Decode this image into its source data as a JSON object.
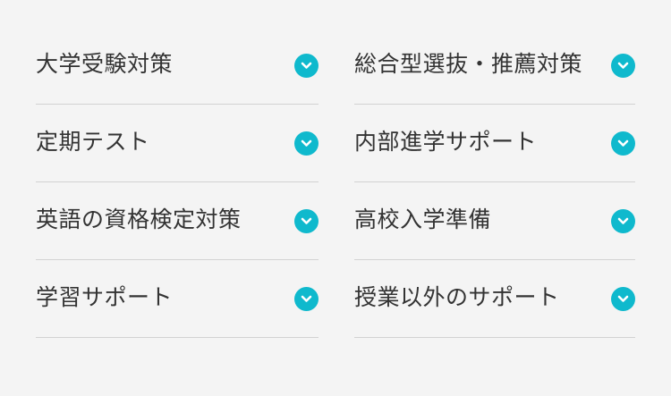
{
  "accent_color": "#0fb9cd",
  "menu": {
    "items": [
      {
        "label": "大学受験対策",
        "icon": "chevron-down-icon"
      },
      {
        "label": "総合型選抜・推薦対策",
        "icon": "chevron-down-icon"
      },
      {
        "label": "定期テスト",
        "icon": "chevron-down-icon"
      },
      {
        "label": "内部進学サポート",
        "icon": "chevron-down-icon"
      },
      {
        "label": "英語の資格検定対策",
        "icon": "chevron-down-icon"
      },
      {
        "label": "高校入学準備",
        "icon": "chevron-down-icon"
      },
      {
        "label": "学習サポート",
        "icon": "chevron-down-icon"
      },
      {
        "label": "授業以外のサポート",
        "icon": "chevron-down-icon"
      }
    ]
  }
}
